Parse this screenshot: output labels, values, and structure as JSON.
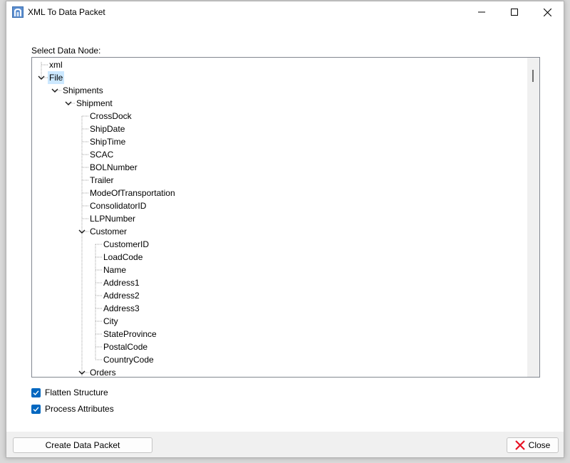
{
  "window": {
    "title": "XML To Data Packet",
    "icon": "app-icon"
  },
  "dialog": {
    "select_label": "Select Data Node:",
    "tree": [
      {
        "label": "xml",
        "depth": 0,
        "expander": "none"
      },
      {
        "label": "File",
        "depth": 0,
        "expander": "expanded",
        "selected": true
      },
      {
        "label": "Shipments",
        "depth": 1,
        "expander": "expanded"
      },
      {
        "label": "Shipment",
        "depth": 2,
        "expander": "expanded"
      },
      {
        "label": "CrossDock",
        "depth": 3,
        "expander": "none"
      },
      {
        "label": "ShipDate",
        "depth": 3,
        "expander": "none"
      },
      {
        "label": "ShipTime",
        "depth": 3,
        "expander": "none"
      },
      {
        "label": "SCAC",
        "depth": 3,
        "expander": "none"
      },
      {
        "label": "BOLNumber",
        "depth": 3,
        "expander": "none"
      },
      {
        "label": "Trailer",
        "depth": 3,
        "expander": "none"
      },
      {
        "label": "ModeOfTransportation",
        "depth": 3,
        "expander": "none"
      },
      {
        "label": "ConsolidatorID",
        "depth": 3,
        "expander": "none"
      },
      {
        "label": "LLPNumber",
        "depth": 3,
        "expander": "none"
      },
      {
        "label": "Customer",
        "depth": 3,
        "expander": "expanded"
      },
      {
        "label": "CustomerID",
        "depth": 4,
        "expander": "none"
      },
      {
        "label": "LoadCode",
        "depth": 4,
        "expander": "none"
      },
      {
        "label": "Name",
        "depth": 4,
        "expander": "none"
      },
      {
        "label": "Address1",
        "depth": 4,
        "expander": "none"
      },
      {
        "label": "Address2",
        "depth": 4,
        "expander": "none"
      },
      {
        "label": "Address3",
        "depth": 4,
        "expander": "none"
      },
      {
        "label": "City",
        "depth": 4,
        "expander": "none"
      },
      {
        "label": "StateProvince",
        "depth": 4,
        "expander": "none"
      },
      {
        "label": "PostalCode",
        "depth": 4,
        "expander": "none"
      },
      {
        "label": "CountryCode",
        "depth": 4,
        "expander": "none"
      },
      {
        "label": "Orders",
        "depth": 3,
        "expander": "expanded"
      }
    ],
    "options": {
      "flatten_label": "Flatten Structure",
      "flatten_checked": true,
      "process_attributes_label": "Process Attributes",
      "process_attributes_checked": true
    }
  },
  "footer": {
    "create_label": "Create Data Packet",
    "close_label": "Close"
  },
  "colors": {
    "accent": "#0067c0",
    "selection": "#cce8ff",
    "close_icon": "#e81123"
  }
}
